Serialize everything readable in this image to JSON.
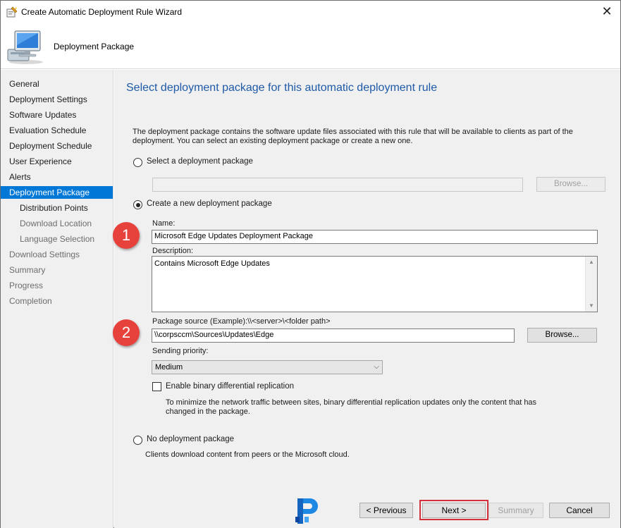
{
  "window": {
    "title": "Create Automatic Deployment Rule Wizard",
    "close_glyph": "✕",
    "header_title": "Deployment Package",
    "title_icon": "wizard-icon",
    "header_icon": "computer-icon"
  },
  "nav": {
    "items": [
      {
        "label": "General",
        "state": "normal"
      },
      {
        "label": "Deployment Settings",
        "state": "normal"
      },
      {
        "label": "Software Updates",
        "state": "normal"
      },
      {
        "label": "Evaluation Schedule",
        "state": "normal"
      },
      {
        "label": "Deployment Schedule",
        "state": "normal"
      },
      {
        "label": "User Experience",
        "state": "normal"
      },
      {
        "label": "Alerts",
        "state": "normal"
      },
      {
        "label": "Deployment Package",
        "state": "selected"
      },
      {
        "label": "Distribution Points",
        "state": "sub"
      },
      {
        "label": "Download Location",
        "state": "sub-disabled"
      },
      {
        "label": "Language Selection",
        "state": "sub-disabled"
      },
      {
        "label": "Download Settings",
        "state": "disabled"
      },
      {
        "label": "Summary",
        "state": "disabled"
      },
      {
        "label": "Progress",
        "state": "disabled"
      },
      {
        "label": "Completion",
        "state": "disabled"
      }
    ]
  },
  "main": {
    "title": "Select deployment package for this automatic deployment rule",
    "intro": "The deployment package contains the software update files associated with this rule that will be available to clients as part of the deployment. You can select an existing deployment package or create a new one.",
    "select_existing": {
      "label": "Select a deployment package",
      "checked": false,
      "value": "",
      "browse": "Browse..."
    },
    "create_new": {
      "label": "Create a new deployment package",
      "checked": true
    },
    "name_label": "Name:",
    "name_value": "Microsoft Edge Updates Deployment Package",
    "description_label": "Description:",
    "description_value": "Contains Microsoft Edge Updates",
    "source_label": "Package source (Example):\\\\<server>\\<folder path>",
    "source_value": "\\\\corpsccm\\Sources\\Updates\\Edge",
    "source_browse": "Browse...",
    "priority_label": "Sending priority:",
    "priority_value": "Medium",
    "binary_diff": {
      "label": "Enable binary differential replication",
      "checked": false
    },
    "binary_note": "To minimize the network traffic between sites, binary differential replication updates only the content that has changed in the package.",
    "no_package": {
      "label": "No deployment package",
      "checked": false
    },
    "no_package_note": "Clients download content from peers or the Microsoft cloud."
  },
  "annotations": {
    "badge1": "1",
    "badge2": "2",
    "badge_color": "#e7413c",
    "highlight_color": "#d2303a"
  },
  "footer": {
    "previous": "< Previous",
    "next": "Next >",
    "summary": "Summary",
    "cancel": "Cancel",
    "logo_letter": "P"
  },
  "colors": {
    "accent": "#0078d7",
    "title_blue": "#1e5aa8",
    "panel": "#f0f0f0"
  }
}
